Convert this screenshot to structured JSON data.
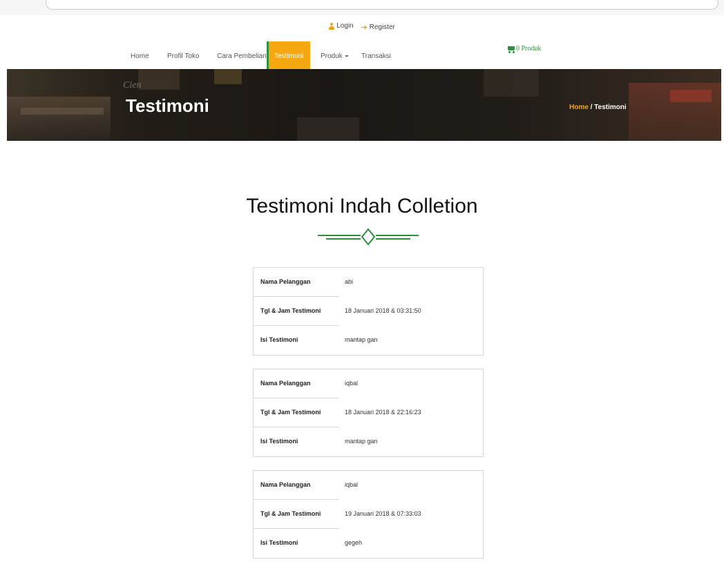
{
  "top_links": {
    "login": "Login",
    "register": "Register"
  },
  "nav": {
    "items": [
      {
        "label": "Home"
      },
      {
        "label": "Profil Toko"
      },
      {
        "label": "Cara Pembelian"
      },
      {
        "label": "Testimoni",
        "active": true
      },
      {
        "label": "Produk",
        "dropdown": true
      },
      {
        "label": "Transaksi"
      }
    ],
    "cart": "0 Produk"
  },
  "banner": {
    "title": "Testimoni",
    "faded_text": "Cien",
    "breadcrumb": {
      "home": "Home",
      "separator": " / ",
      "current": "Testimoni"
    }
  },
  "section": {
    "title": "Testimoni Indah Colletion"
  },
  "field_labels": {
    "name": "Nama Pelanggan",
    "datetime": "Tgl & Jam Testimoni",
    "content": "Isi Testimoni"
  },
  "testimonials": [
    {
      "name": "abi",
      "datetime": "18 Januari 2018 & 03:31:50",
      "content": "mantap gan"
    },
    {
      "name": "iqbal",
      "datetime": "18 Januari 2018 & 22:16:23",
      "content": "mantap gan"
    },
    {
      "name": "iqbal",
      "datetime": "19 Januari 2018 & 07:33:03",
      "content": "gegeh"
    }
  ],
  "colors": {
    "accent": "#f6a811",
    "brand_green": "#2f8f3c"
  }
}
